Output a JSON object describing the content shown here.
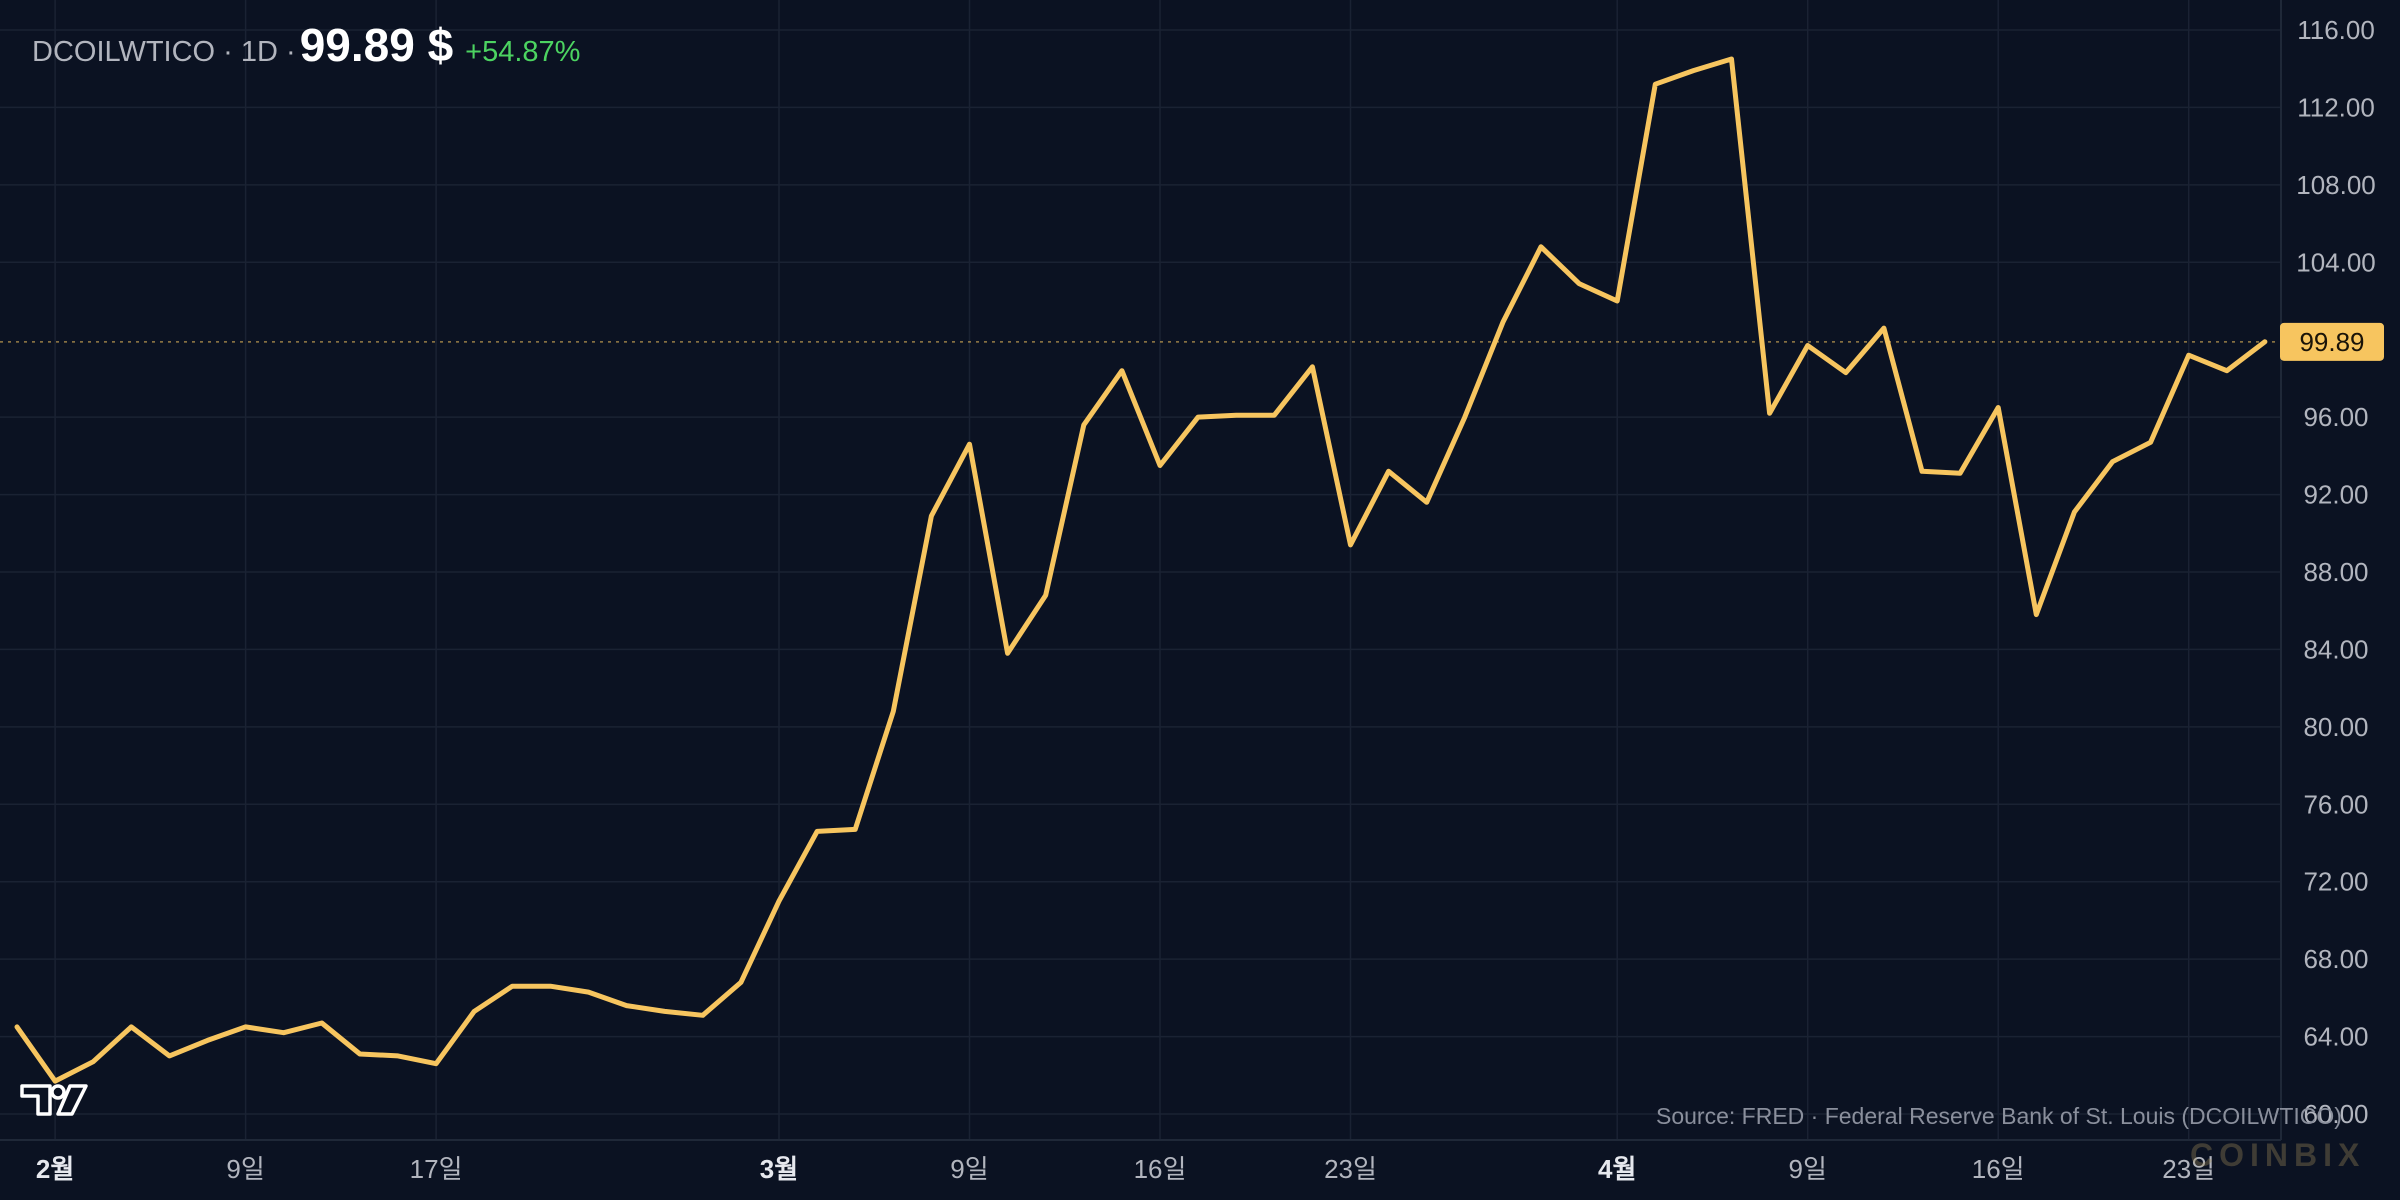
{
  "header": {
    "symbol_line": "DCOILWTICO · 1D ·",
    "price": "99.89 $",
    "change": "+54.87%"
  },
  "source_note": "Source: FRED · Federal Reserve Bank of St. Louis (DCOILWTICO)",
  "watermark": "COINBIX",
  "colors": {
    "background": "#0b1222",
    "line": "#f7c55f",
    "grid": "#1a2233",
    "axis_text": "#b2b5be",
    "change_positive": "#4cd361"
  },
  "chart_data": {
    "type": "line",
    "title": "",
    "xlabel": "",
    "ylabel": "",
    "y_axis_position": "right",
    "ylim": [
      60,
      116
    ],
    "y_ticks": [
      "60.00",
      "64.00",
      "68.00",
      "72.00",
      "76.00",
      "80.00",
      "84.00",
      "88.00",
      "92.00",
      "96.00",
      "99.89",
      "104.00",
      "108.00",
      "112.00",
      "116.00"
    ],
    "x_ticks": [
      {
        "label": "2월",
        "index": 1,
        "bold": true
      },
      {
        "label": "9일",
        "index": 6,
        "bold": false
      },
      {
        "label": "17일",
        "index": 11,
        "bold": false
      },
      {
        "label": "3월",
        "index": 20,
        "bold": true
      },
      {
        "label": "9일",
        "index": 25,
        "bold": false
      },
      {
        "label": "16일",
        "index": 30,
        "bold": false
      },
      {
        "label": "23일",
        "index": 35,
        "bold": false
      },
      {
        "label": "4월",
        "index": 42,
        "bold": true
      },
      {
        "label": "9일",
        "index": 47,
        "bold": false
      },
      {
        "label": "16일",
        "index": 52,
        "bold": false
      },
      {
        "label": "23일",
        "index": 57,
        "bold": false
      }
    ],
    "grid": true,
    "last_value_label": "99.89",
    "last_value": 99.89,
    "series": [
      {
        "values": [
          64.5,
          61.7,
          62.7,
          64.5,
          63.0,
          63.8,
          64.5,
          64.2,
          64.7,
          63.1,
          63.0,
          62.6,
          65.3,
          66.6,
          66.6,
          66.3,
          65.6,
          65.3,
          65.1,
          66.8,
          71.0,
          74.6,
          74.7,
          80.8,
          90.9,
          94.6,
          83.8,
          86.8,
          95.6,
          98.4,
          93.5,
          96.0,
          96.1,
          96.1,
          98.6,
          89.4,
          93.2,
          91.6,
          96.0,
          100.9,
          104.8,
          102.9,
          102.0,
          113.2,
          113.9,
          114.5,
          96.2,
          99.7,
          98.3,
          100.6,
          93.2,
          93.1,
          96.5,
          85.8,
          91.1,
          93.7,
          94.7,
          99.2,
          98.4,
          99.89
        ]
      }
    ]
  }
}
